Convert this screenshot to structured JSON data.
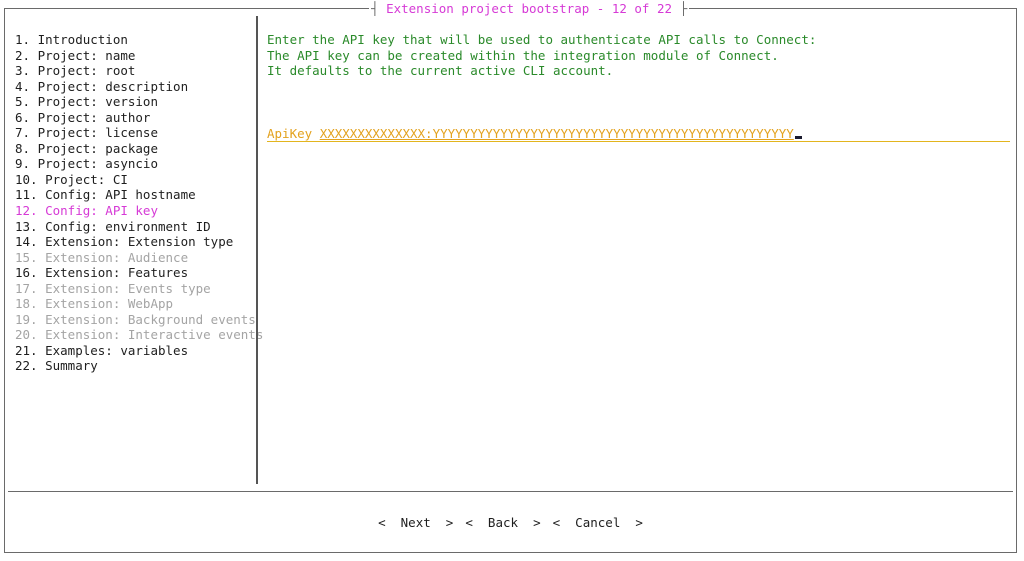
{
  "window": {
    "title": "Extension project bootstrap - 12 of 22"
  },
  "steps": [
    {
      "label": "1. Introduction",
      "state": "normal"
    },
    {
      "label": "2. Project: name",
      "state": "normal"
    },
    {
      "label": "3. Project: root",
      "state": "normal"
    },
    {
      "label": "4. Project: description",
      "state": "normal"
    },
    {
      "label": "5. Project: version",
      "state": "normal"
    },
    {
      "label": "6. Project: author",
      "state": "normal"
    },
    {
      "label": "7. Project: license",
      "state": "normal"
    },
    {
      "label": "8. Project: package",
      "state": "normal"
    },
    {
      "label": "9. Project: asyncio",
      "state": "normal"
    },
    {
      "label": "10. Project: CI",
      "state": "normal"
    },
    {
      "label": "11. Config: API hostname",
      "state": "normal"
    },
    {
      "label": "12. Config: API key",
      "state": "active"
    },
    {
      "label": "13. Config: environment ID",
      "state": "normal"
    },
    {
      "label": "14. Extension: Extension type",
      "state": "normal"
    },
    {
      "label": "15. Extension: Audience",
      "state": "disabled"
    },
    {
      "label": "16. Extension: Features",
      "state": "normal"
    },
    {
      "label": "17. Extension: Events type",
      "state": "disabled"
    },
    {
      "label": "18. Extension: WebApp",
      "state": "disabled"
    },
    {
      "label": "19. Extension: Background events",
      "state": "disabled"
    },
    {
      "label": "20. Extension: Interactive events",
      "state": "disabled"
    },
    {
      "label": "21. Examples: variables",
      "state": "normal"
    },
    {
      "label": "22. Summary",
      "state": "normal"
    }
  ],
  "description": {
    "lines": [
      "Enter the API key that will be used to authenticate API calls to Connect:",
      "The API key can be created within the integration module of Connect.",
      "It defaults to the current active CLI account."
    ]
  },
  "field": {
    "label": "ApiKey ",
    "value": "XXXXXXXXXXXXXX:YYYYYYYYYYYYYYYYYYYYYYYYYYYYYYYYYYYYYYYYYYYYYYYY"
  },
  "buttons": {
    "next": "<  Next  >",
    "back": "<  Back  >",
    "cancel": "<  Cancel  >"
  },
  "colors": {
    "active": "#d63ad6",
    "disabled": "#a4a4a4",
    "description": "#2a8a2a",
    "field": "#e3a21e"
  }
}
